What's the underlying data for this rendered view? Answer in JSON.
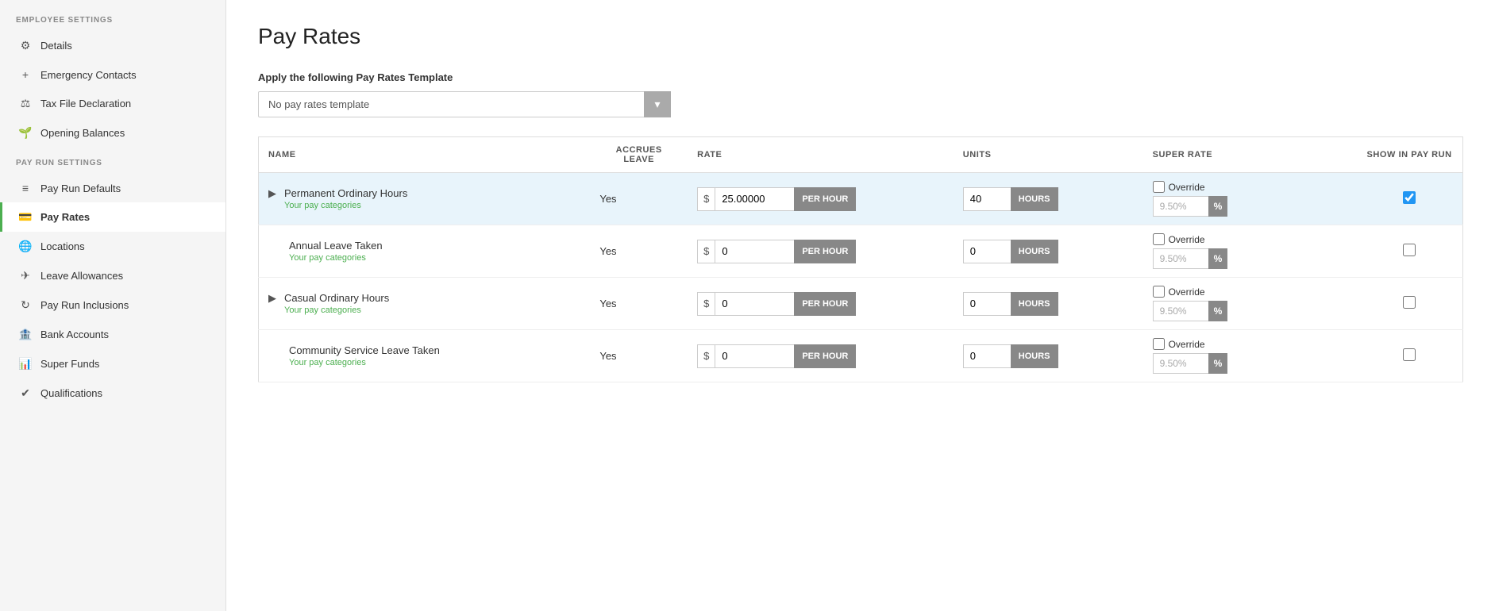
{
  "sidebar": {
    "employee_settings_label": "EMPLOYEE SETTINGS",
    "pay_run_settings_label": "PAY RUN SETTINGS",
    "items": [
      {
        "id": "details",
        "label": "Details",
        "icon": "⚙",
        "active": false
      },
      {
        "id": "emergency-contacts",
        "label": "Emergency Contacts",
        "icon": "+",
        "active": false
      },
      {
        "id": "tax-file-declaration",
        "label": "Tax File Declaration",
        "icon": "⚖",
        "active": false
      },
      {
        "id": "opening-balances",
        "label": "Opening Balances",
        "icon": "🌿",
        "active": false
      },
      {
        "id": "pay-run-defaults",
        "label": "Pay Run Defaults",
        "icon": "☰",
        "active": false
      },
      {
        "id": "pay-rates",
        "label": "Pay Rates",
        "icon": "💳",
        "active": true
      },
      {
        "id": "locations",
        "label": "Locations",
        "icon": "🌐",
        "active": false
      },
      {
        "id": "leave-allowances",
        "label": "Leave Allowances",
        "icon": "✈",
        "active": false
      },
      {
        "id": "pay-run-inclusions",
        "label": "Pay Run Inclusions",
        "icon": "↻",
        "active": false
      },
      {
        "id": "bank-accounts",
        "label": "Bank Accounts",
        "icon": "🏦",
        "active": false
      },
      {
        "id": "super-funds",
        "label": "Super Funds",
        "icon": "📊",
        "active": false
      },
      {
        "id": "qualifications",
        "label": "Qualifications",
        "icon": "✔",
        "active": false
      }
    ]
  },
  "main": {
    "page_title": "Pay Rates",
    "template_section_label": "Apply the following Pay Rates Template",
    "template_placeholder": "No pay rates template",
    "table": {
      "columns": {
        "name": "NAME",
        "accrues_leave": "ACCRUES LEAVE",
        "rate": "RATE",
        "units": "UNITS",
        "super_rate": "SUPER RATE",
        "show_in_pay_run": "SHOW IN PAY RUN"
      },
      "rows": [
        {
          "id": "row1",
          "has_chevron": true,
          "name": "Permanent Ordinary Hours",
          "sub": "Your pay categories",
          "accrues": "Yes",
          "rate_value": "25.00000",
          "rate_unit": "PER HOUR",
          "units_value": "40",
          "units_unit": "HOURS",
          "override_checked": false,
          "super_rate": "9.50%",
          "show_in_run": true,
          "highlighted": true
        },
        {
          "id": "row2",
          "has_chevron": false,
          "name": "Annual Leave Taken",
          "sub": "Your pay categories",
          "accrues": "Yes",
          "rate_value": "0",
          "rate_unit": "PER HOUR",
          "units_value": "0",
          "units_unit": "HOURS",
          "override_checked": false,
          "super_rate": "9.50%",
          "show_in_run": false,
          "highlighted": false
        },
        {
          "id": "row3",
          "has_chevron": true,
          "name": "Casual Ordinary Hours",
          "sub": "Your pay categories",
          "accrues": "Yes",
          "rate_value": "0",
          "rate_unit": "PER HOUR",
          "units_value": "0",
          "units_unit": "HOURS",
          "override_checked": false,
          "super_rate": "9.50%",
          "show_in_run": false,
          "highlighted": false
        },
        {
          "id": "row4",
          "has_chevron": false,
          "name": "Community Service Leave Taken",
          "sub": "Your pay categories",
          "accrues": "Yes",
          "rate_value": "0",
          "rate_unit": "PER HOUR",
          "units_value": "0",
          "units_unit": "HOURS",
          "override_checked": false,
          "super_rate": "9.50%",
          "show_in_run": false,
          "highlighted": false
        }
      ]
    }
  }
}
